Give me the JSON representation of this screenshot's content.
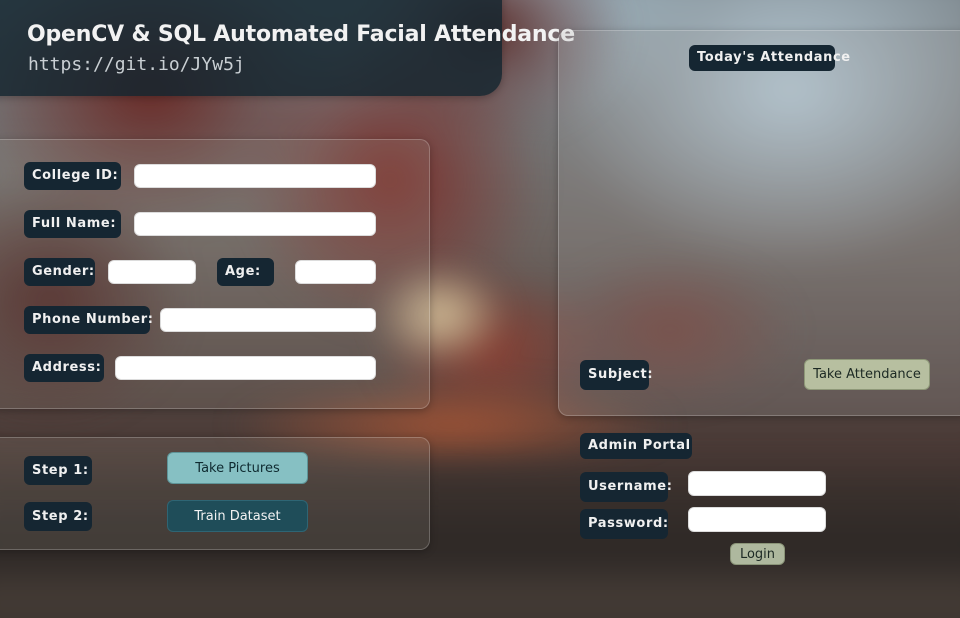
{
  "header": {
    "title": "OpenCV & SQL  Automated Facial Attendance",
    "url": "https://git.io/JYw5j"
  },
  "registration": {
    "college_id_label": "College ID:",
    "college_id_value": "",
    "full_name_label": "Full Name:",
    "full_name_value": "",
    "gender_label": "Gender:",
    "gender_value": "",
    "age_label": "Age:",
    "age_value": "",
    "phone_label": "Phone Number:",
    "phone_value": "",
    "address_label": "Address:",
    "address_value": ""
  },
  "steps": {
    "step1_label": "Step 1:",
    "step1_button": "Take Pictures",
    "step2_label": "Step 2:",
    "step2_button": "Train Dataset"
  },
  "attendance": {
    "title": "Today's Attendance",
    "subject_label": "Subject:",
    "take_button": "Take Attendance"
  },
  "admin": {
    "title": "Admin Portal",
    "username_label": "Username:",
    "username_value": "",
    "password_label": "Password:",
    "password_value": "",
    "login_button": "Login"
  },
  "colors": {
    "label_bg": "#152632",
    "title_bg": "#12242e",
    "take_pictures_btn": "#86c0c3",
    "train_btn": "#1f4d59",
    "attendance_btn": "#b7bfa0",
    "login_btn": "#aeb89e"
  }
}
